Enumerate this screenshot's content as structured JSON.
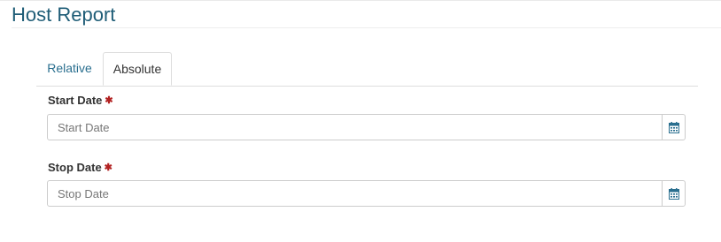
{
  "page": {
    "title": "Host Report"
  },
  "tabs": [
    {
      "label": "Relative",
      "active": false
    },
    {
      "label": "Absolute",
      "active": true
    }
  ],
  "form": {
    "start_date": {
      "label": "Start Date",
      "required_mark": "✱",
      "value": "",
      "placeholder": "Start Date",
      "icon": "calendar-icon"
    },
    "stop_date": {
      "label": "Stop Date",
      "required_mark": "✱",
      "value": "",
      "placeholder": "Stop Date",
      "icon": "calendar-icon"
    }
  },
  "colors": {
    "title": "#1f5d77",
    "link_tab": "#2a6f8f",
    "required": "#b22222",
    "icon": "#2a6f8f"
  }
}
